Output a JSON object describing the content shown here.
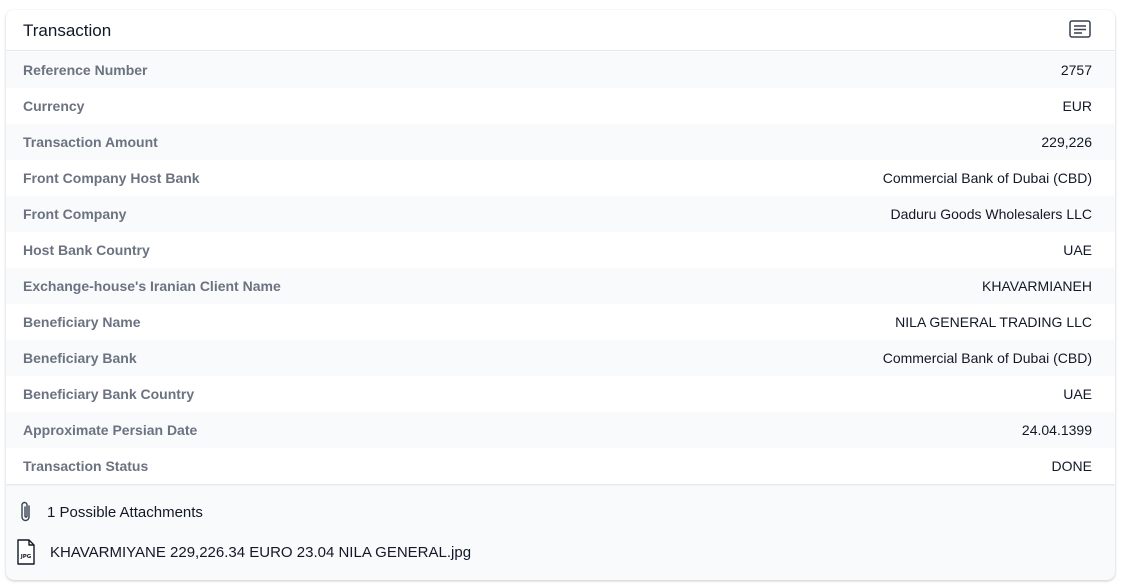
{
  "card": {
    "title": "Transaction",
    "header_icon": "notes-icon"
  },
  "fields": [
    {
      "label": "Reference Number",
      "value": "2757"
    },
    {
      "label": "Currency",
      "value": "EUR"
    },
    {
      "label": "Transaction Amount",
      "value": "229,226"
    },
    {
      "label": "Front Company Host Bank",
      "value": "Commercial Bank of Dubai (CBD)"
    },
    {
      "label": "Front Company",
      "value": "Daduru Goods Wholesalers LLC"
    },
    {
      "label": "Host Bank Country",
      "value": "UAE"
    },
    {
      "label": "Exchange-house's Iranian Client Name",
      "value": "KHAVARMIANEH"
    },
    {
      "label": "Beneficiary Name",
      "value": "NILA GENERAL TRADING LLC"
    },
    {
      "label": "Beneficiary Bank",
      "value": "Commercial Bank of Dubai (CBD)"
    },
    {
      "label": "Beneficiary Bank Country",
      "value": "UAE"
    },
    {
      "label": "Approximate Persian Date",
      "value": "24.04.1399"
    },
    {
      "label": "Transaction Status",
      "value": "DONE"
    }
  ],
  "attachments": {
    "heading": "1 Possible Attachments",
    "heading_icon": "paperclip-icon",
    "files": [
      {
        "name": "KHAVARMIYANE 229,226.34 EURO 23.04 NILA GENERAL.jpg",
        "icon": "jpg-file-icon",
        "icon_text": "JPG"
      }
    ]
  },
  "colors": {
    "label_text": "#6b7280",
    "value_text": "#111827",
    "stripe": "#f9fafb",
    "border": "#e5e7eb"
  }
}
